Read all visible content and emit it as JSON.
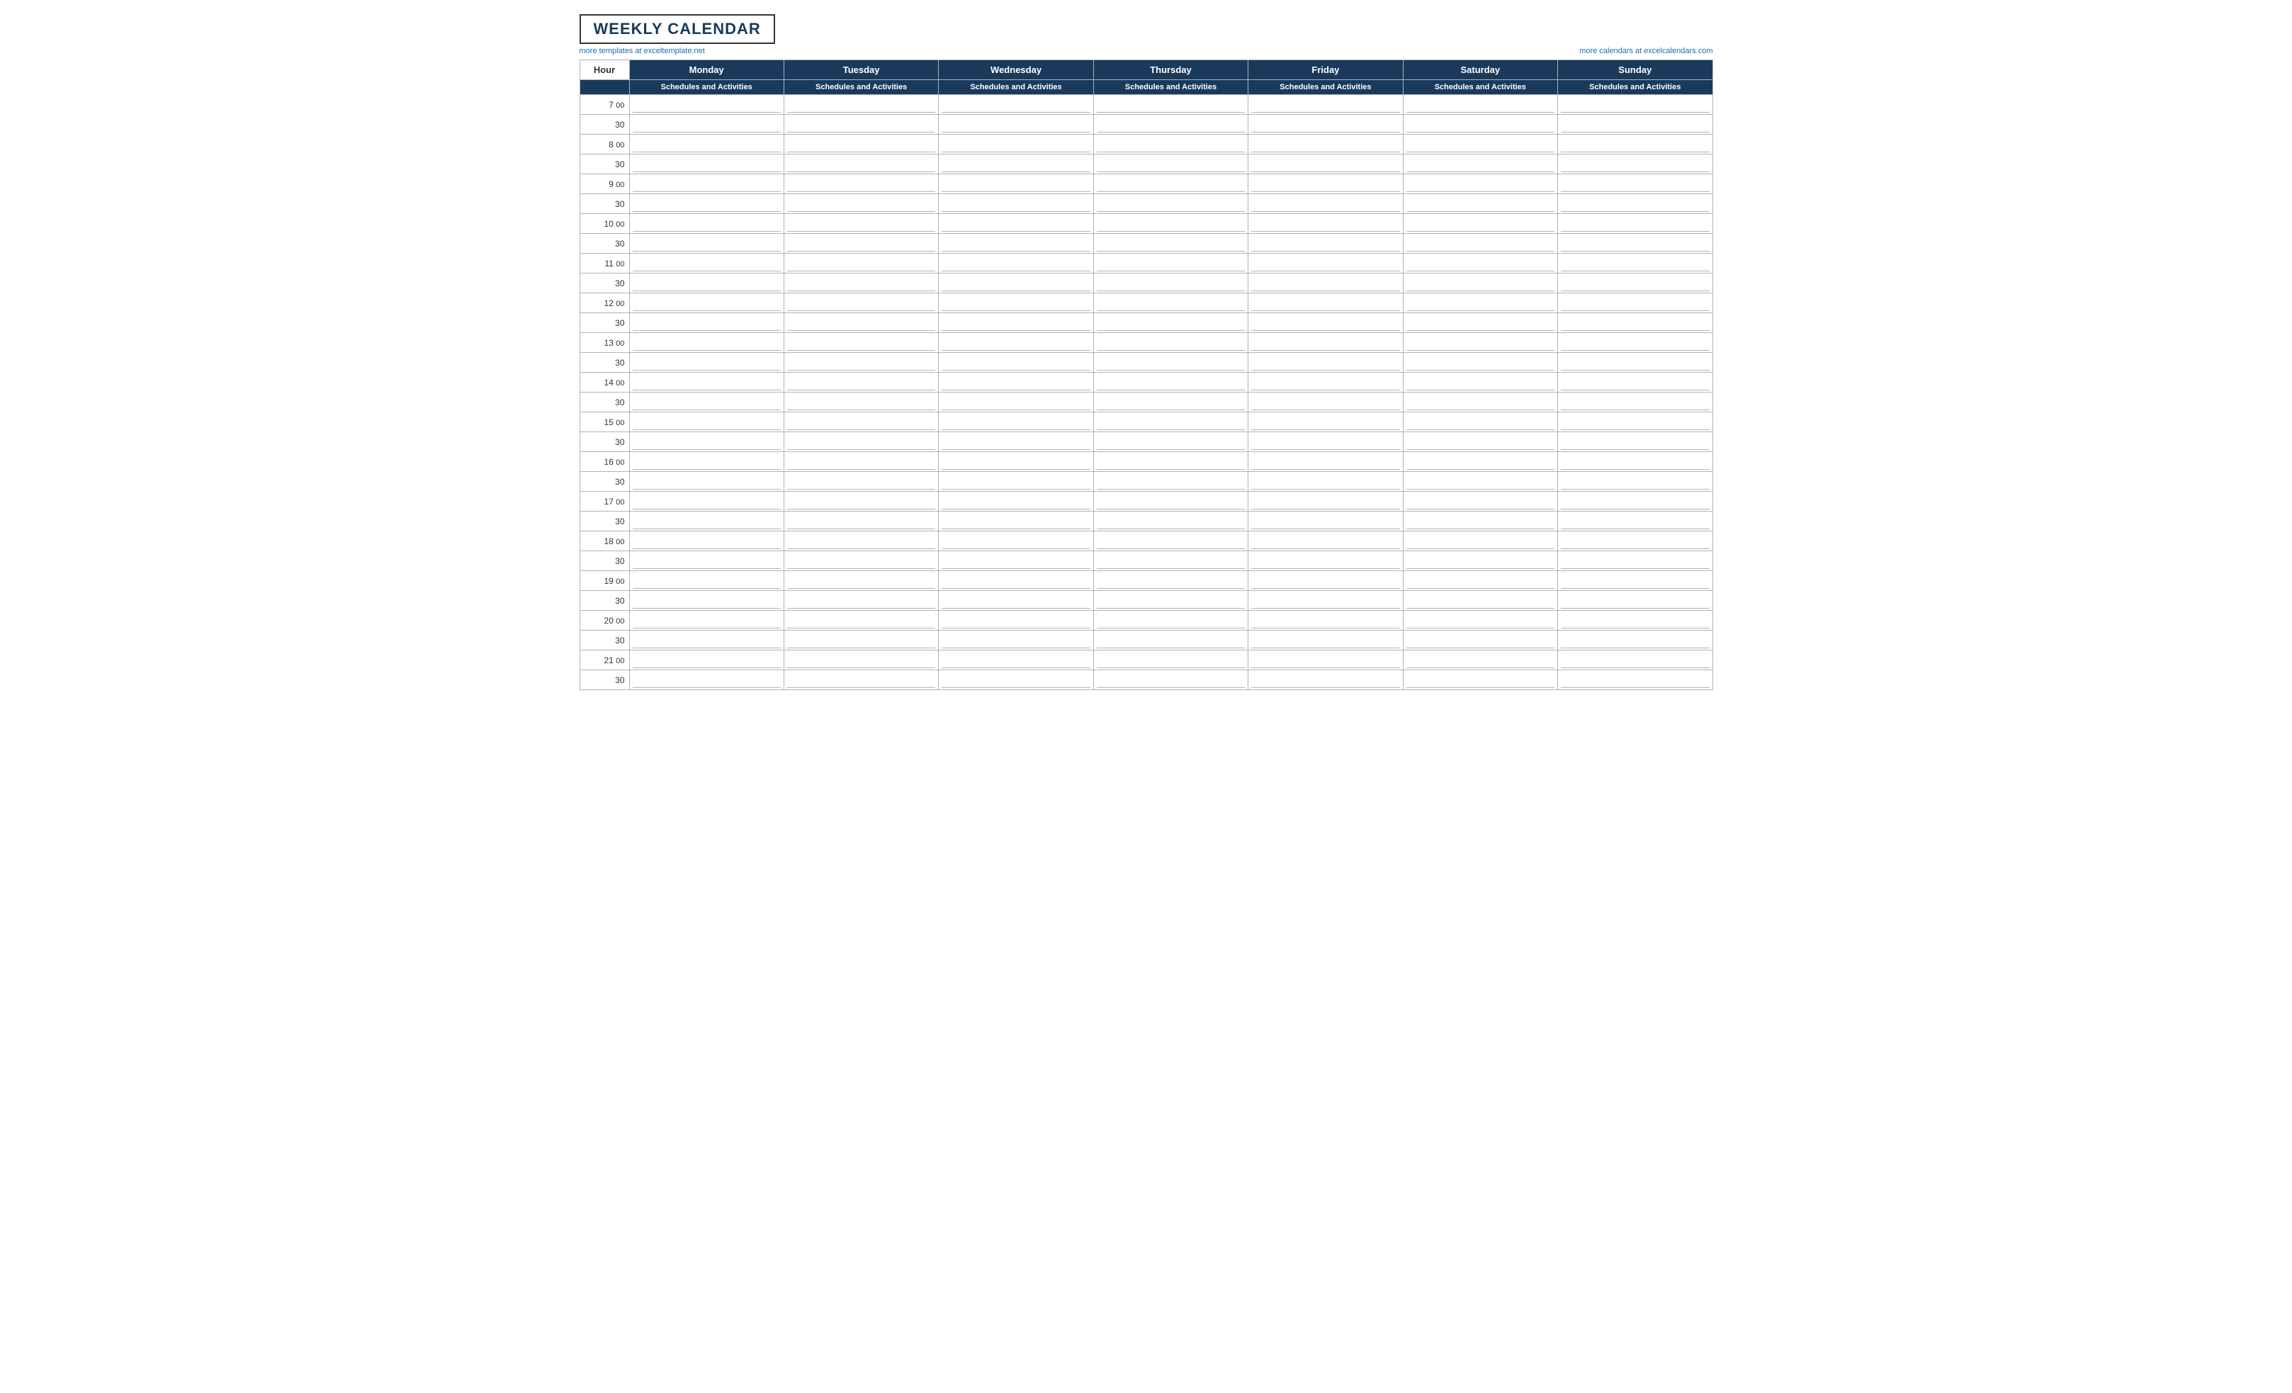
{
  "title": "WEEKLY CALENDAR",
  "link_left": "more templates at exceltemplate.net",
  "link_right": "more calendars at excelcalendars.com",
  "header": {
    "hour_label": "Hour",
    "days": [
      "Monday",
      "Tuesday",
      "Wednesday",
      "Thursday",
      "Friday",
      "Saturday",
      "Sunday"
    ],
    "subheader": "Schedules and Activities"
  },
  "time_slots": [
    {
      "hour": "7",
      "min": "00"
    },
    {
      "hour": "",
      "min": "30"
    },
    {
      "hour": "8",
      "min": "00"
    },
    {
      "hour": "",
      "min": "30"
    },
    {
      "hour": "9",
      "min": "00"
    },
    {
      "hour": "",
      "min": "30"
    },
    {
      "hour": "10",
      "min": "00"
    },
    {
      "hour": "",
      "min": "30"
    },
    {
      "hour": "11",
      "min": "00"
    },
    {
      "hour": "",
      "min": "30"
    },
    {
      "hour": "12",
      "min": "00"
    },
    {
      "hour": "",
      "min": "30"
    },
    {
      "hour": "13",
      "min": "00"
    },
    {
      "hour": "",
      "min": "30"
    },
    {
      "hour": "14",
      "min": "00"
    },
    {
      "hour": "",
      "min": "30"
    },
    {
      "hour": "15",
      "min": "00"
    },
    {
      "hour": "",
      "min": "30"
    },
    {
      "hour": "16",
      "min": "00"
    },
    {
      "hour": "",
      "min": "30"
    },
    {
      "hour": "17",
      "min": "00"
    },
    {
      "hour": "",
      "min": "30"
    },
    {
      "hour": "18",
      "min": "00"
    },
    {
      "hour": "",
      "min": "30"
    },
    {
      "hour": "19",
      "min": "00"
    },
    {
      "hour": "",
      "min": "30"
    },
    {
      "hour": "20",
      "min": "00"
    },
    {
      "hour": "",
      "min": "30"
    },
    {
      "hour": "21",
      "min": "00"
    },
    {
      "hour": "",
      "min": "30"
    }
  ]
}
